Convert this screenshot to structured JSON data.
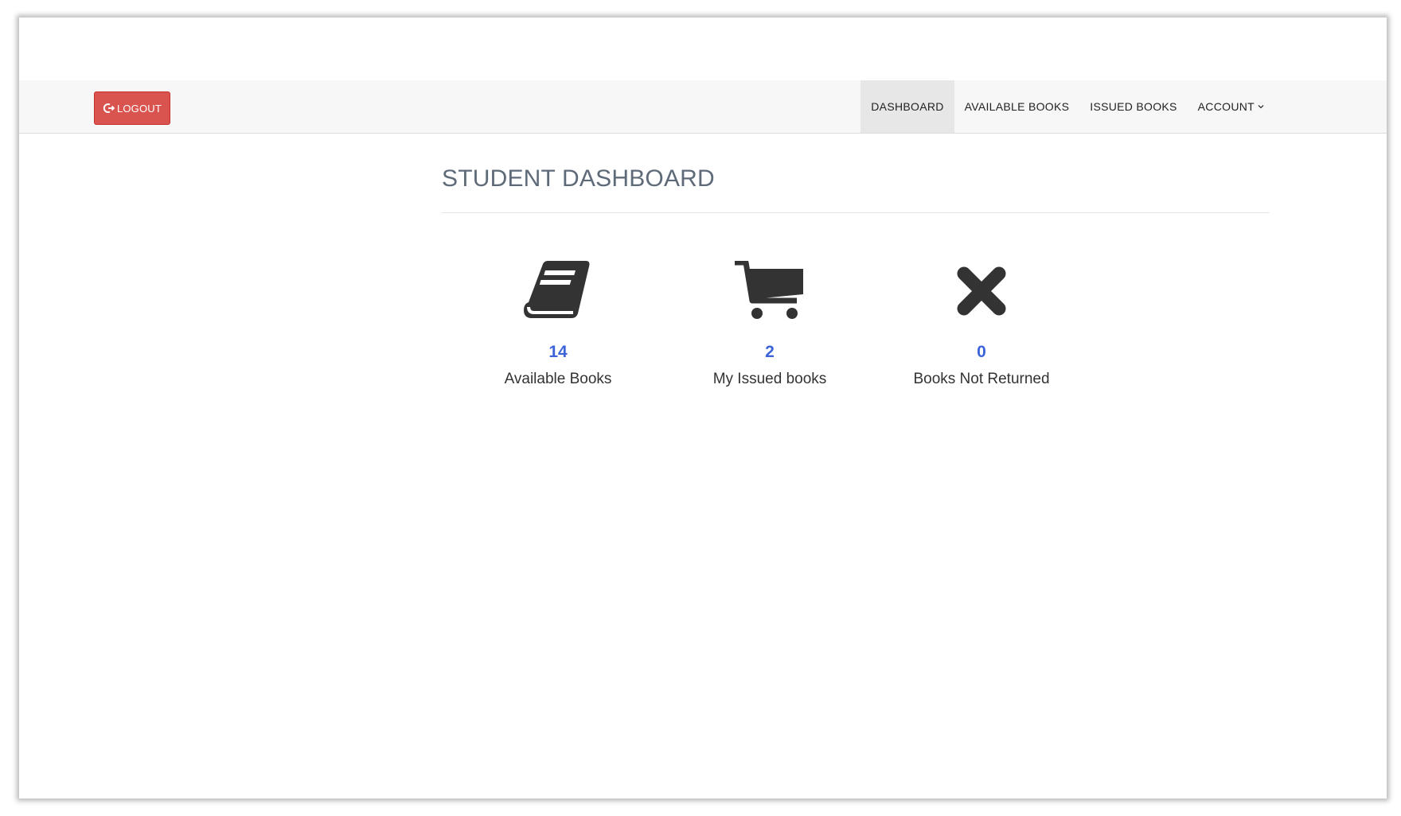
{
  "navbar": {
    "logout_label": "LOGOUT",
    "menu": [
      {
        "label": "DASHBOARD",
        "active": true
      },
      {
        "label": "AVAILABLE BOOKS",
        "active": false
      },
      {
        "label": "ISSUED BOOKS",
        "active": false
      },
      {
        "label": "ACCOUNT",
        "active": false,
        "dropdown": true
      }
    ]
  },
  "main": {
    "title": "STUDENT DASHBOARD",
    "stats": [
      {
        "icon": "book-icon",
        "count": "14",
        "label": "Available Books"
      },
      {
        "icon": "cart-icon",
        "count": "2",
        "label": "My Issued books"
      },
      {
        "icon": "times-icon",
        "count": "0",
        "label": "Books Not Returned"
      }
    ]
  },
  "colors": {
    "logout_button": "#d9534f",
    "count_text": "#3c64d8",
    "title_text": "#5f6a79",
    "icon": "#333333"
  }
}
